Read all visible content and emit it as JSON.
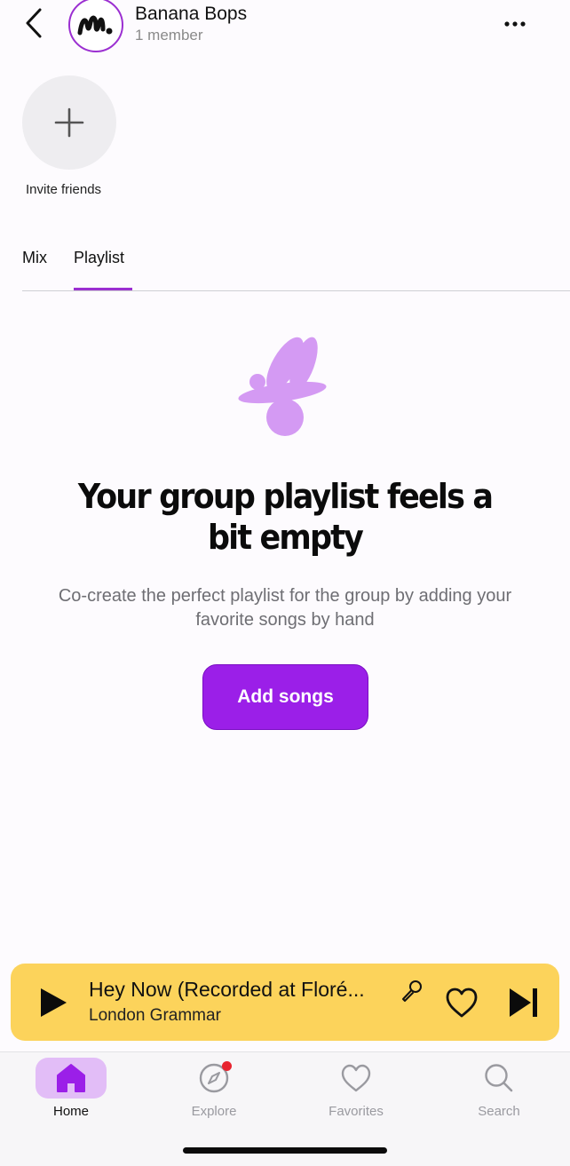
{
  "header": {
    "title": "Banana Bops",
    "subtitle": "1 member",
    "avatar_text": "M."
  },
  "invite": {
    "label": "Invite friends"
  },
  "tabs": [
    {
      "label": "Mix",
      "active": false
    },
    {
      "label": "Playlist",
      "active": true
    }
  ],
  "empty_state": {
    "title_line1": "Your group playlist feels a",
    "title_line2": "bit empty",
    "description_line1": "Co-create the perfect playlist for the group by adding your",
    "description_line2": "favorite songs by hand",
    "button_label": "Add songs"
  },
  "now_playing": {
    "title": "Hey Now (Recorded at Floré...",
    "artist": "London Grammar",
    "state": "paused",
    "icons": [
      "play-icon",
      "microphone-icon",
      "heart-icon",
      "skip-next-icon"
    ]
  },
  "tab_bar": {
    "items": [
      {
        "label": "Home",
        "icon": "home-icon",
        "active": true,
        "badge": false
      },
      {
        "label": "Explore",
        "icon": "compass-icon",
        "active": false,
        "badge": true
      },
      {
        "label": "Favorites",
        "icon": "heart-icon",
        "active": false,
        "badge": false
      },
      {
        "label": "Search",
        "icon": "search-icon",
        "active": false,
        "badge": false
      }
    ]
  },
  "colors": {
    "accent": "#9b1fe8",
    "accent_light": "#e2bdf7",
    "player_bg": "#fcd35b",
    "badge": "#e8242f"
  }
}
